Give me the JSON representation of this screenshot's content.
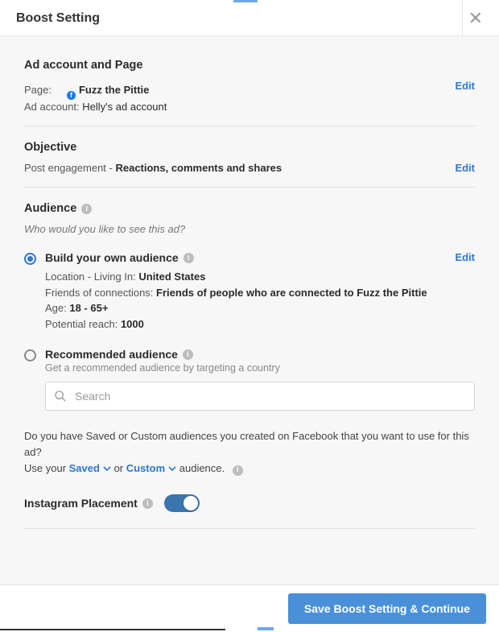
{
  "header": {
    "title": "Boost Setting"
  },
  "account": {
    "heading": "Ad account and Page",
    "page_label": "Page:",
    "page_name": "Fuzz the Pittie",
    "ad_account_label": "Ad account:",
    "ad_account_name": "Helly's ad account",
    "edit_label": "Edit"
  },
  "objective": {
    "heading": "Objective",
    "prefix": "Post engagement - ",
    "detail": "Reactions, comments and shares",
    "edit_label": "Edit"
  },
  "audience": {
    "heading": "Audience",
    "subheading": "Who would you like to see this ad?",
    "build": {
      "title": "Build your own audience",
      "edit_label": "Edit",
      "loc_label": "Location - Living In: ",
      "loc_value": "United States",
      "friends_label": "Friends of connections: ",
      "friends_value": "Friends of people who are connected to Fuzz the Pittie",
      "age_label": "Age: ",
      "age_value": "18 - 65+",
      "reach_label": "Potential reach: ",
      "reach_value": "1000"
    },
    "recommended": {
      "title": "Recommended audience",
      "sub": "Get a recommended audience by targeting a country",
      "search_placeholder": "Search"
    },
    "saved": {
      "question": "Do you have Saved or Custom audiences you created on Facebook that you want to use for this ad?",
      "use_prefix": "Use your ",
      "saved_label": "Saved",
      "or_text": " or ",
      "custom_label": "Custom",
      "suffix": " audience."
    }
  },
  "instagram": {
    "label": "Instagram Placement",
    "on": true
  },
  "footer": {
    "save_label": "Save Boost Setting & Continue"
  }
}
